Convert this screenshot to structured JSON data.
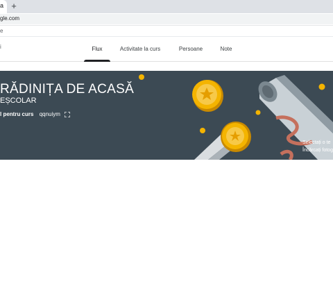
{
  "browser": {
    "tab_title": "a",
    "new_tab_symbol": "+",
    "url": "gle.com",
    "bookmark_text": "e"
  },
  "header": {
    "menu_glyph": "i",
    "tabs": [
      {
        "label": "Flux",
        "active": true
      },
      {
        "label": "Activitate la curs",
        "active": false
      },
      {
        "label": "Persoane",
        "active": false
      },
      {
        "label": "Note",
        "active": false
      }
    ]
  },
  "banner": {
    "title": "RĂDINIȚA DE ACASĂ",
    "subtitle": "EȘCOLAR",
    "code_label": "l pentru curs",
    "code_value": "qqnuiym",
    "theme_links": [
      "Selectați o te",
      "Încărcați fotogr"
    ],
    "icons": [
      "expand-icon",
      "coin-icon",
      "trophy-icon",
      "diploma-icon"
    ],
    "colors": {
      "background": "#3c4a54",
      "coin": "#f4b400",
      "ribbon": "#c5705d"
    }
  }
}
